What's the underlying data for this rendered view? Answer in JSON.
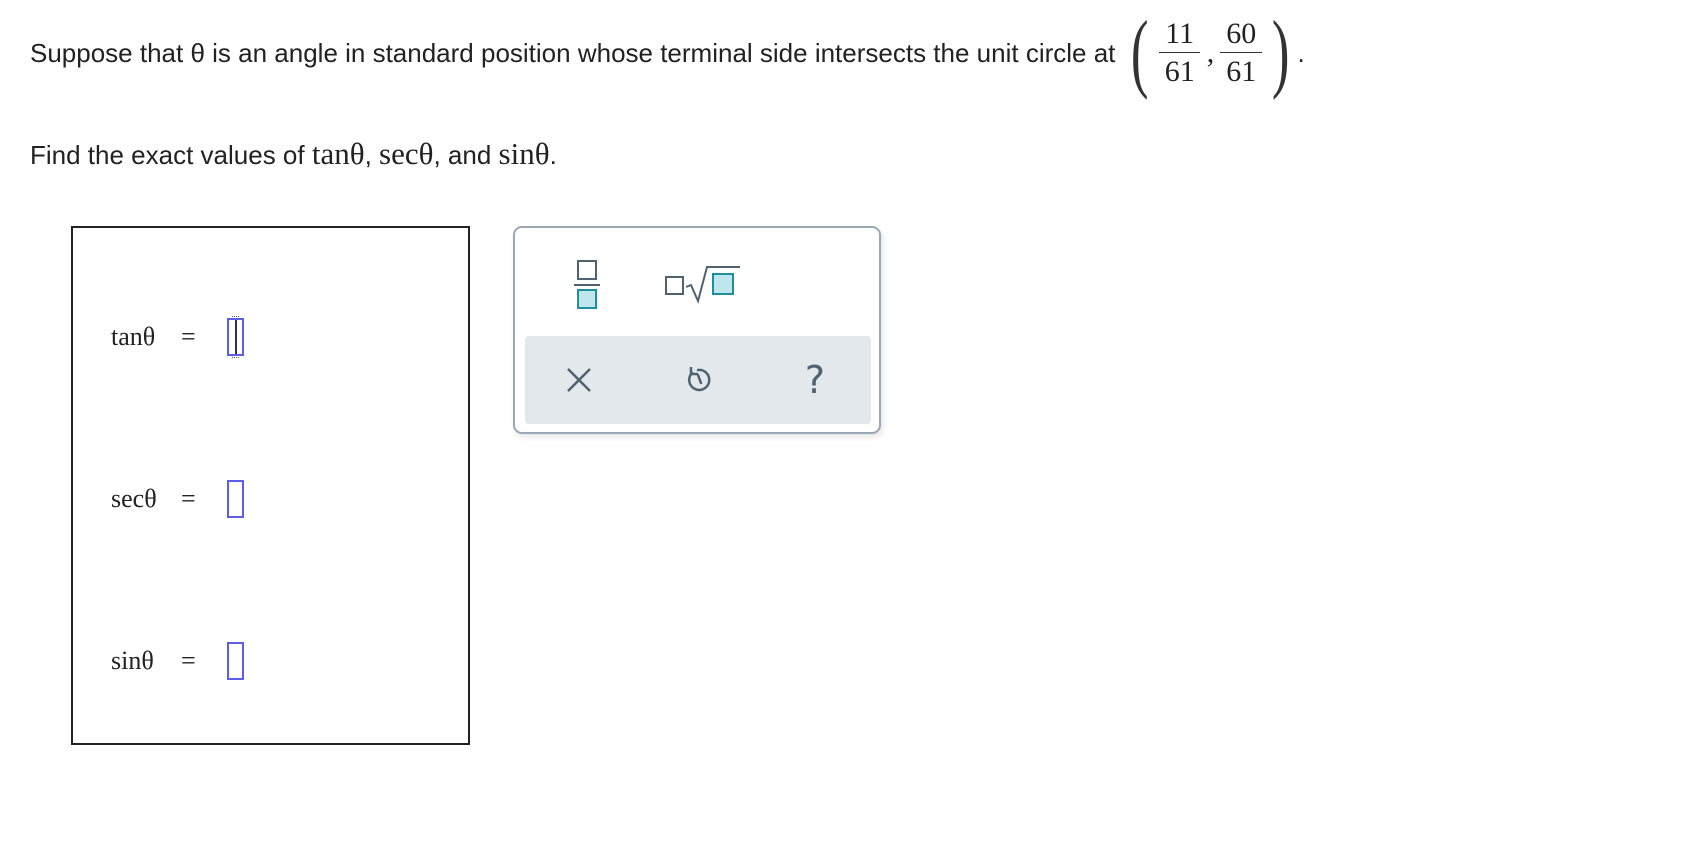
{
  "question": {
    "line1_text": "Suppose that θ is an angle in standard position whose terminal side intersects the unit circle at",
    "point": {
      "x_num": "11",
      "x_den": "61",
      "y_num": "60",
      "y_den": "61"
    },
    "line2_prefix": "Find the exact values of",
    "tan_expr": "tanθ",
    "sep1": ",",
    "sec_expr": "secθ",
    "sep2": ", and",
    "sin_expr": "sinθ",
    "end": "."
  },
  "answers": [
    {
      "label": "tanθ",
      "eq": "=",
      "value": ""
    },
    {
      "label": "secθ",
      "eq": "=",
      "value": ""
    },
    {
      "label": "sinθ",
      "eq": "=",
      "value": ""
    }
  ],
  "palette": {
    "tools": [
      "fraction-icon",
      "square-root-icon"
    ],
    "actions": [
      "clear-icon",
      "undo-icon",
      "help-icon"
    ]
  },
  "colors": {
    "input_border": "#5a5ee8",
    "icon_teal": "#1f8ea3",
    "icon_gray": "#4f6272",
    "action_bar_bg": "#e3e8ec"
  }
}
